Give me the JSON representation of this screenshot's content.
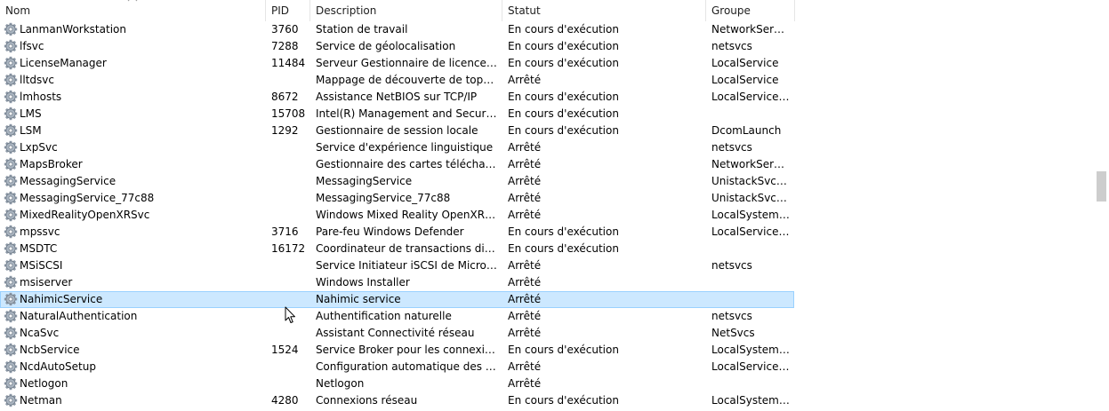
{
  "columns": {
    "name": "Nom",
    "pid": "PID",
    "description": "Description",
    "status": "Statut",
    "group": "Groupe"
  },
  "icons": {
    "row_icon": "gear-icon",
    "sort_indicator": "sort-arrow-up-icon",
    "pointer": "mouse-cursor-icon"
  },
  "colors": {
    "selection_bg": "#cce8ff",
    "selection_border": "#99d1ff"
  },
  "selected_row": "NahimicService",
  "services": [
    {
      "name": "LanmanWorkstation",
      "pid": "3760",
      "description": "Station de travail",
      "status": "En cours d'exécution",
      "group": "NetworkService"
    },
    {
      "name": "lfsvc",
      "pid": "7288",
      "description": "Service de géolocalisation",
      "status": "En cours d'exécution",
      "group": "netsvcs"
    },
    {
      "name": "LicenseManager",
      "pid": "11484",
      "description": "Serveur Gestionnaire de licences Win...",
      "status": "En cours d'exécution",
      "group": "LocalService"
    },
    {
      "name": "lltdsvc",
      "pid": "",
      "description": "Mappage de découverte de topologi...",
      "status": "Arrêté",
      "group": "LocalService"
    },
    {
      "name": "lmhosts",
      "pid": "8672",
      "description": "Assistance NetBIOS sur TCP/IP",
      "status": "En cours d'exécution",
      "group": "LocalServiceN..."
    },
    {
      "name": "LMS",
      "pid": "15708",
      "description": "Intel(R) Management and Security A...",
      "status": "En cours d'exécution",
      "group": ""
    },
    {
      "name": "LSM",
      "pid": "1292",
      "description": "Gestionnaire de session locale",
      "status": "En cours d'exécution",
      "group": "DcomLaunch"
    },
    {
      "name": "LxpSvc",
      "pid": "",
      "description": "Service d'expérience linguistique",
      "status": "Arrêté",
      "group": "netsvcs"
    },
    {
      "name": "MapsBroker",
      "pid": "",
      "description": "Gestionnaire des cartes téléchargées",
      "status": "Arrêté",
      "group": "NetworkService"
    },
    {
      "name": "MessagingService",
      "pid": "",
      "description": "MessagingService",
      "status": "Arrêté",
      "group": "UnistackSvcGr..."
    },
    {
      "name": "MessagingService_77c88",
      "pid": "",
      "description": "MessagingService_77c88",
      "status": "Arrêté",
      "group": "UnistackSvcGr..."
    },
    {
      "name": "MixedRealityOpenXRSvc",
      "pid": "",
      "description": "Windows Mixed Reality OpenXR Ser...",
      "status": "Arrêté",
      "group": "LocalSystemN..."
    },
    {
      "name": "mpssvc",
      "pid": "3716",
      "description": "Pare-feu Windows Defender",
      "status": "En cours d'exécution",
      "group": "LocalServiceN..."
    },
    {
      "name": "MSDTC",
      "pid": "16172",
      "description": "Coordinateur de transactions distrib...",
      "status": "En cours d'exécution",
      "group": ""
    },
    {
      "name": "MSiSCSI",
      "pid": "",
      "description": "Service Initiateur iSCSI de Microsoft",
      "status": "Arrêté",
      "group": "netsvcs"
    },
    {
      "name": "msiserver",
      "pid": "",
      "description": "Windows Installer",
      "status": "Arrêté",
      "group": ""
    },
    {
      "name": "NahimicService",
      "pid": "",
      "description": "Nahimic service",
      "status": "Arrêté",
      "group": ""
    },
    {
      "name": "NaturalAuthentication",
      "pid": "",
      "description": "Authentification naturelle",
      "status": "Arrêté",
      "group": "netsvcs"
    },
    {
      "name": "NcaSvc",
      "pid": "",
      "description": "Assistant Connectivité réseau",
      "status": "Arrêté",
      "group": "NetSvcs"
    },
    {
      "name": "NcbService",
      "pid": "1524",
      "description": "Service Broker pour les connexions r...",
      "status": "En cours d'exécution",
      "group": "LocalSystemN..."
    },
    {
      "name": "NcdAutoSetup",
      "pid": "",
      "description": "Configuration automatique des péri...",
      "status": "Arrêté",
      "group": "LocalServiceN..."
    },
    {
      "name": "Netlogon",
      "pid": "",
      "description": "Netlogon",
      "status": "Arrêté",
      "group": ""
    },
    {
      "name": "Netman",
      "pid": "4280",
      "description": "Connexions réseau",
      "status": "En cours d'exécution",
      "group": "LocalSystemN..."
    }
  ]
}
